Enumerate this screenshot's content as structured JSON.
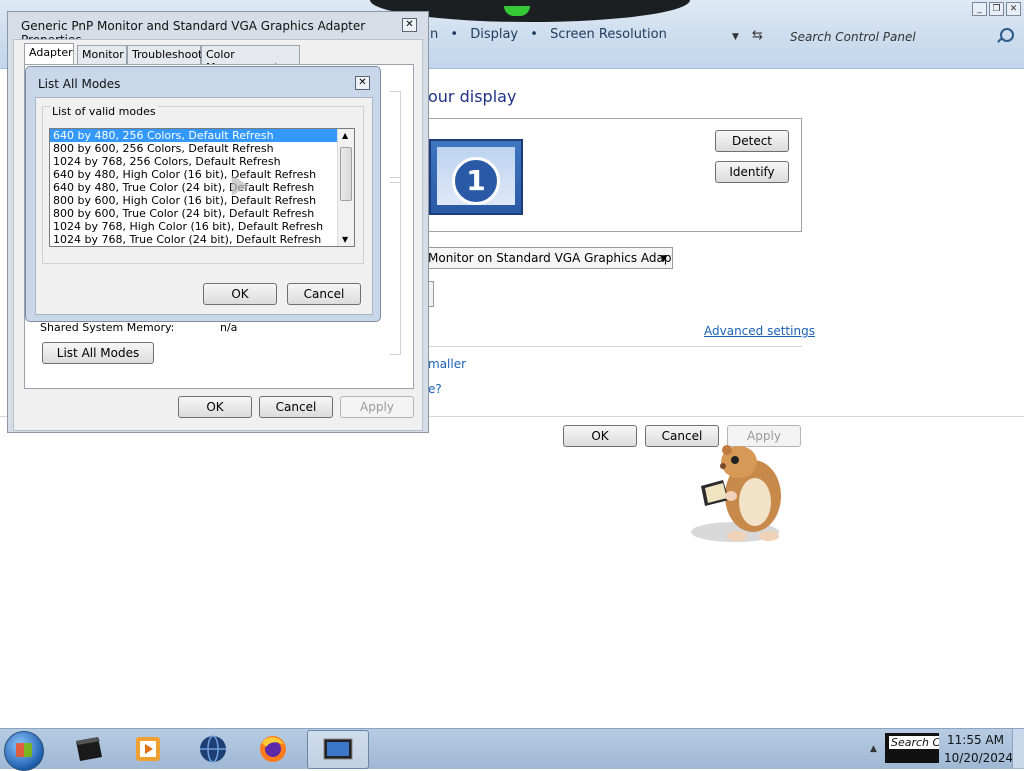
{
  "control_panel": {
    "breadcrumb_partial": "n",
    "breadcrumb_display": "Display",
    "breadcrumb_screen_resolution": "Screen Resolution",
    "search_placeholder": "Search Control Panel",
    "heading_partial": "our display",
    "monitor_number": "1",
    "detect_label": "Detect",
    "identify_label": "Identify",
    "display_select_value": "Monitor on Standard VGA Graphics Adapter",
    "advanced_settings_link": "Advanced settings",
    "link1_partial": "maller",
    "link2_partial": "e?",
    "ok_label": "OK",
    "cancel_label": "Cancel",
    "apply_label": "Apply"
  },
  "properties_dialog": {
    "title": "Generic PnP Monitor and Standard VGA Graphics Adapter Properties",
    "tabs": [
      {
        "label": "Adapter"
      },
      {
        "label": "Monitor"
      },
      {
        "label": "Troubleshoot"
      },
      {
        "label": "Color Management"
      }
    ],
    "shared_memory_label": "Shared System Memory:",
    "shared_memory_value": "n/a",
    "list_all_modes_label": "List All Modes",
    "ok_label": "OK",
    "cancel_label": "Cancel",
    "apply_label": "Apply"
  },
  "list_all_modes_dialog": {
    "title": "List All Modes",
    "group_label": "List of valid modes",
    "modes": [
      "640 by 480, 256 Colors, Default Refresh",
      "800 by 600, 256 Colors, Default Refresh",
      "1024 by 768, 256 Colors, Default Refresh",
      "640 by 480, High Color (16 bit), Default Refresh",
      "640 by 480, True Color (24 bit), Default Refresh",
      "800 by 600, High Color (16 bit), Default Refresh",
      "800 by 600, True Color (24 bit), Default Refresh",
      "1024 by 768, High Color (16 bit), Default Refresh",
      "1024 by 768, True Color (24 bit), Default Refresh"
    ],
    "selected_index": 0,
    "ok_label": "OK",
    "cancel_label": "Cancel"
  },
  "taskbar": {
    "tray_search_text": "Search Co",
    "time": "11:55 AM",
    "date": "10/20/2024"
  },
  "colors": {
    "selection": "#3399ff",
    "link": "#1a62b8",
    "heading": "#1e3287"
  }
}
